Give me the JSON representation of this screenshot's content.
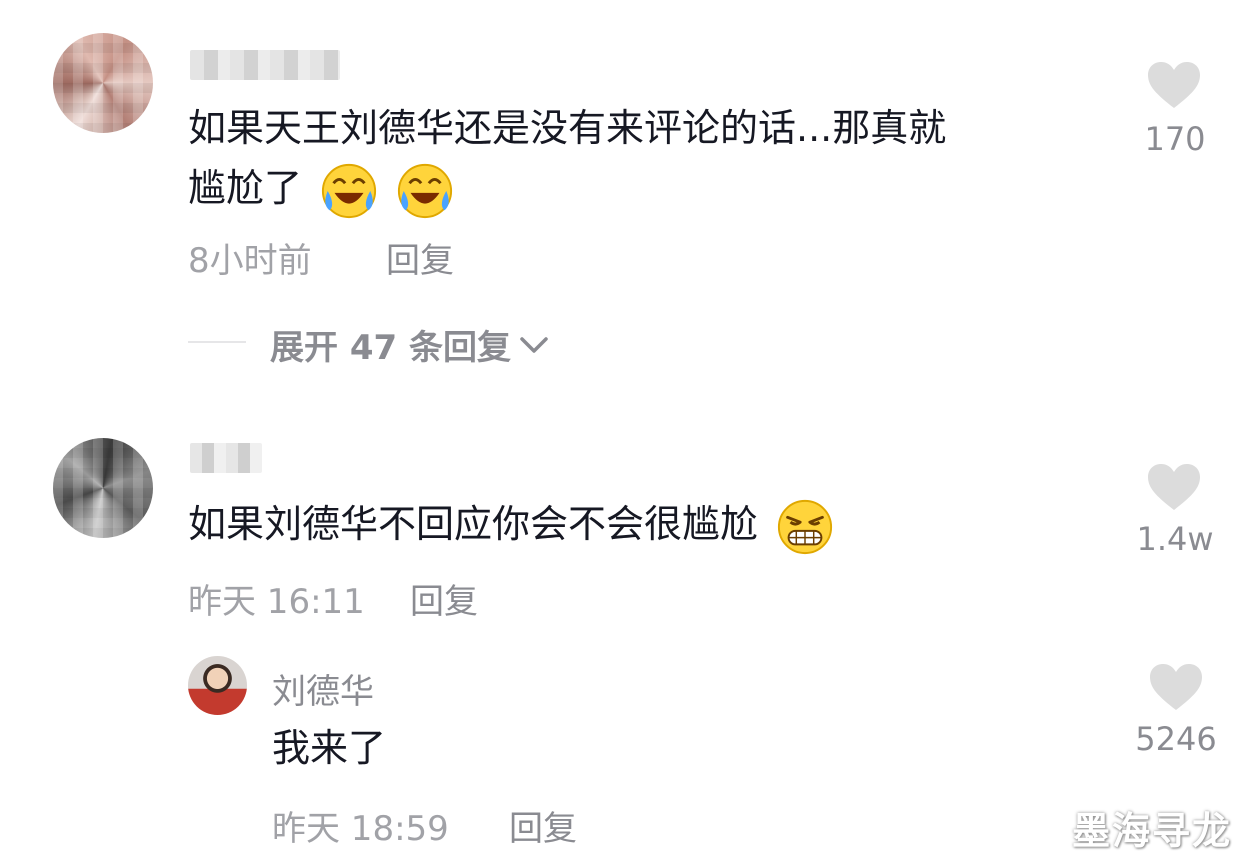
{
  "comments": [
    {
      "text_line1": "如果天王刘德华还是没有来评论的话...那真就",
      "text_line2": "尴尬了",
      "emojis": [
        "laugh-cry-emoji",
        "laugh-cry-emoji"
      ],
      "time": "8小时前",
      "reply_label": "回复",
      "likes": "170",
      "expand_label": "展开 47 条回复"
    },
    {
      "text": "如果刘德华不回应你会不会很尴尬",
      "emojis": [
        "smirk-grin-emoji"
      ],
      "time": "昨天 16:11",
      "reply_label": "回复",
      "likes": "1.4w",
      "reply": {
        "author": "刘德华",
        "text": "我来了",
        "time": "昨天 18:59",
        "reply_label": "回复",
        "likes": "5246"
      }
    }
  ],
  "watermark": "墨海寻龙",
  "colors": {
    "text": "#161823",
    "meta": "#a1a2a7",
    "heart": "#dcdcdc"
  }
}
